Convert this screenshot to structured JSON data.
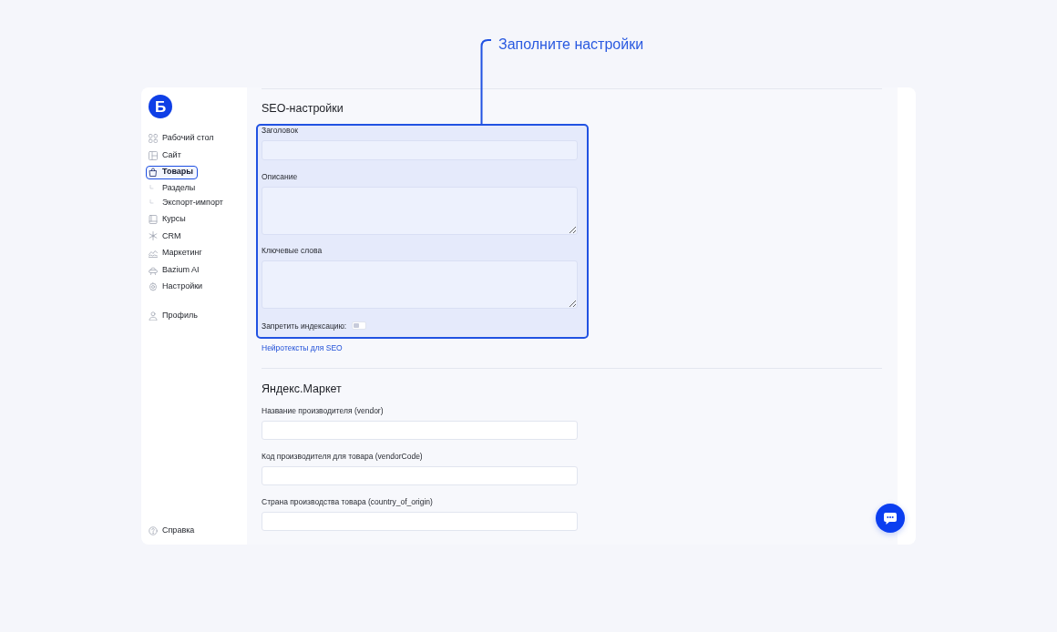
{
  "callout": {
    "text": "Заполните настройки"
  },
  "sidebar": {
    "logo": "Б",
    "items": [
      {
        "label": "Рабочий стол",
        "selected": false
      },
      {
        "label": "Сайт",
        "selected": false
      },
      {
        "label": "Товары",
        "selected": true,
        "children": [
          {
            "label": "Разделы",
            "selected": false
          },
          {
            "label": "Экспорт-импорт",
            "selected": false
          }
        ]
      },
      {
        "label": "Курсы",
        "selected": false
      },
      {
        "label": "CRM",
        "selected": false
      },
      {
        "label": "Маркетинг",
        "selected": false
      },
      {
        "label": "Bazium AI",
        "selected": false
      },
      {
        "label": "Настройки",
        "selected": false
      }
    ],
    "profile": {
      "label": "Профиль",
      "selected": false
    },
    "help": {
      "label": "Справка",
      "selected": false
    }
  },
  "seo": {
    "title": "SEO-настройки",
    "highlighted": true,
    "fields": [
      {
        "kind": "input",
        "label": "Заголовок"
      },
      {
        "kind": "textarea",
        "label": "Описание"
      },
      {
        "kind": "textarea",
        "label": "Ключевые слова"
      }
    ],
    "noindex": {
      "label": "Запретить индексацию:",
      "on": false
    },
    "link": "Нейротексты для SEO"
  },
  "yandex_market": {
    "title": "Яндекс.Маркет",
    "fields": [
      {
        "kind": "input",
        "label": "Название производителя (vendor)"
      },
      {
        "kind": "input",
        "label": "Код производителя для товара (vendorCode)"
      },
      {
        "kind": "input",
        "label": "Страна производства товара (country_of_origin)"
      }
    ]
  }
}
